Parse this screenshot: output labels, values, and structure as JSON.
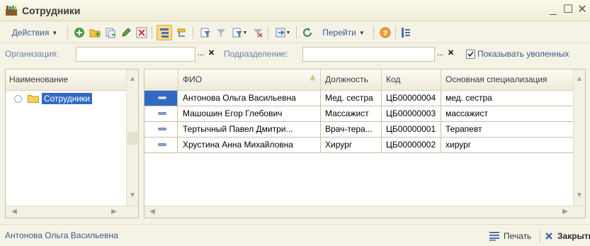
{
  "window": {
    "title": "Сотрудники",
    "minimize": "_",
    "maximize": "☐",
    "close": "✕"
  },
  "toolbar": {
    "actions_label": "Действия",
    "goto_label": "Перейти"
  },
  "filter": {
    "org_label": "Организация:",
    "org_value": "",
    "dept_label": "Подразделение:",
    "dept_value": "",
    "select_btn": "...",
    "clear_btn": "✕",
    "show_dismissed_label": "Показывать уволенных",
    "show_dismissed": true
  },
  "tree": {
    "header": "Наименование",
    "items": [
      {
        "label": "Сотрудники"
      }
    ]
  },
  "table": {
    "columns": [
      "ФИО",
      "Должность",
      "Код",
      "Основная специализация"
    ],
    "rows": [
      {
        "fio": "Антонова Ольга Васильевна",
        "position": "Мед. сестра",
        "code": "ЦБ00000004",
        "spec": "мед. сестра"
      },
      {
        "fio": "Машошин Егор Глебович",
        "position": "Массажист",
        "code": "ЦБ00000003",
        "spec": "массажист"
      },
      {
        "fio": "Тертычный Павел Дмитри...",
        "position": "Врач-тера...",
        "code": "ЦБ00000001",
        "spec": "Терапевт"
      },
      {
        "fio": "Хрустина Анна Михайловна",
        "position": "Хирург",
        "code": "ЦБ00000002",
        "spec": "хирург"
      }
    ]
  },
  "status": {
    "current": "Антонова Ольга Васильевна",
    "print_label": "Печать",
    "close_label": "Закрыть"
  },
  "colors": {
    "selection": "#316ac5",
    "link": "#3a5a8a",
    "window_bg": "#f5f3e6"
  }
}
